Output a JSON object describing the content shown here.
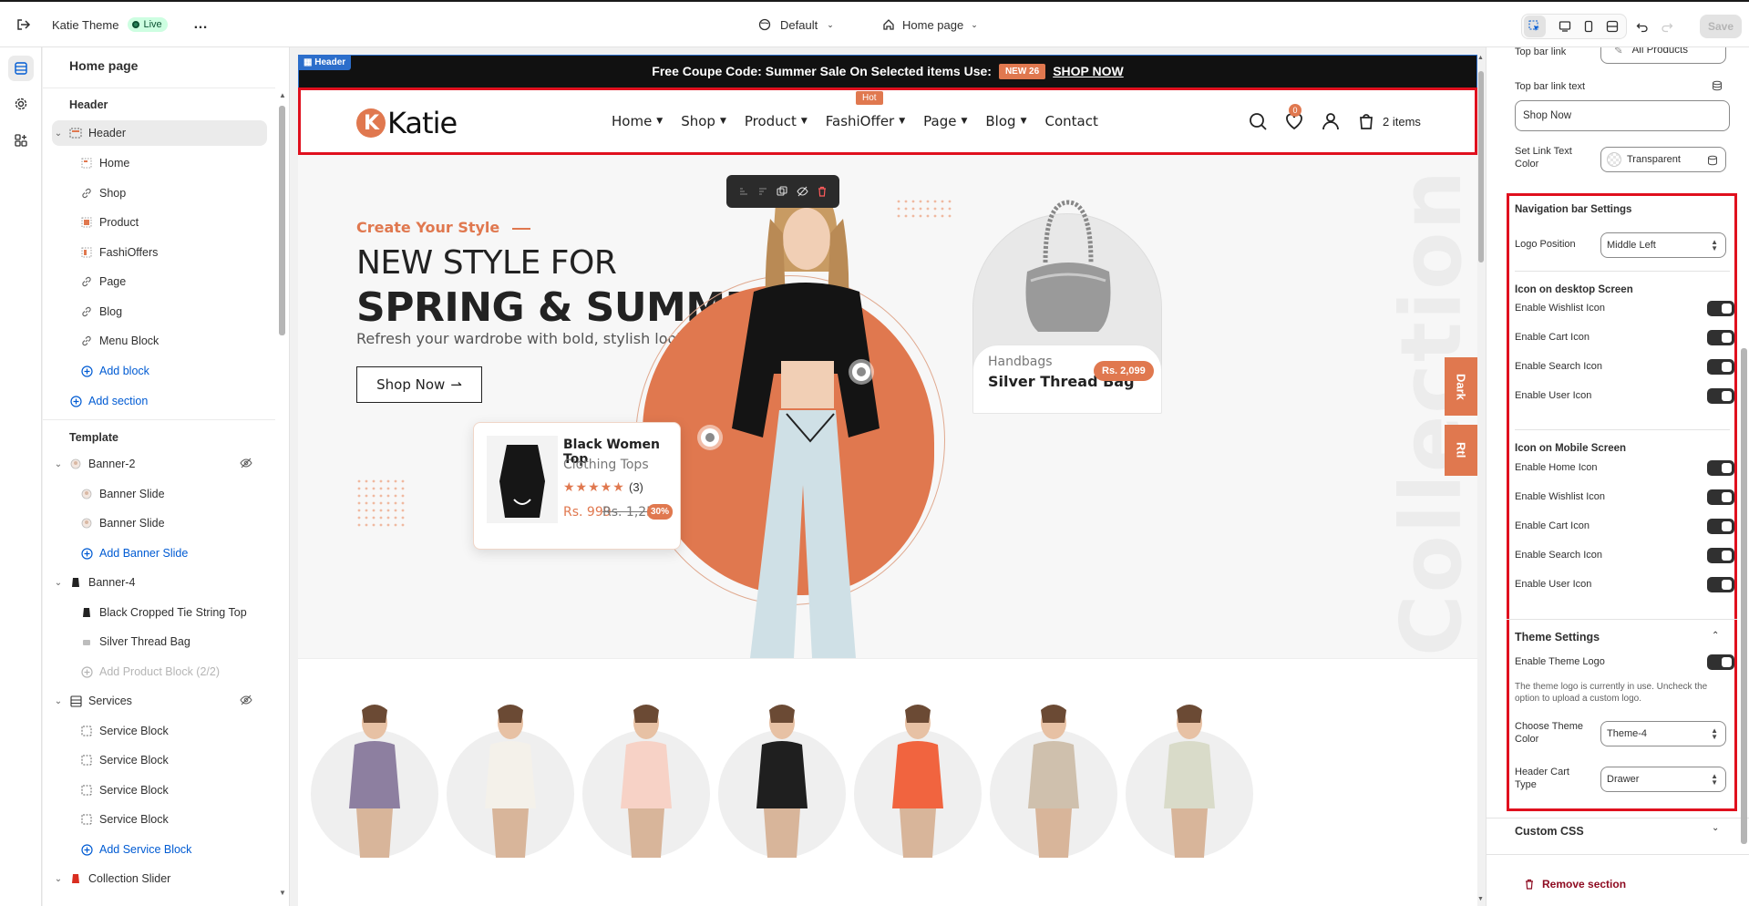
{
  "topbar": {
    "theme_name": "Katie Theme",
    "live_label": "Live",
    "more_label": "…",
    "preset": "Default",
    "page_selector": "Home page",
    "save_label": "Save"
  },
  "left_panel": {
    "title": "Home page",
    "header_section_label": "Header",
    "header_group": {
      "label": "Header",
      "items": [
        {
          "label": "Home",
          "icon": "menu-icon"
        },
        {
          "label": "Shop",
          "icon": "link-icon"
        },
        {
          "label": "Product",
          "icon": "menu-icon"
        },
        {
          "label": "FashiOffers",
          "icon": "menu-icon"
        },
        {
          "label": "Page",
          "icon": "link-icon"
        },
        {
          "label": "Blog",
          "icon": "link-icon"
        },
        {
          "label": "Menu Block",
          "icon": "link-icon"
        }
      ],
      "add_block": "Add block"
    },
    "add_section": "Add section",
    "template_label": "Template",
    "banner2": {
      "label": "Banner-2",
      "items": [
        "Banner Slide",
        "Banner Slide"
      ],
      "add": "Add Banner Slide"
    },
    "banner4": {
      "label": "Banner-4",
      "items": [
        "Black Cropped Tie String Top",
        "Silver Thread Bag"
      ],
      "add": "Add Product Block (2/2)"
    },
    "services": {
      "label": "Services",
      "items": [
        "Service Block",
        "Service Block",
        "Service Block",
        "Service Block"
      ],
      "add": "Add Service Block"
    },
    "collection_slider": {
      "label": "Collection Slider"
    }
  },
  "store": {
    "header_tag": "Header",
    "announcement": {
      "text": "Free Coupe Code: Summer Sale On Selected items Use:",
      "code": "NEW 26",
      "link": "SHOP NOW"
    },
    "logo_text": "Katie",
    "menu": [
      "Home",
      "Shop",
      "Product",
      "FashiOffer",
      "Page",
      "Blog",
      "Contact"
    ],
    "hot_badge": "Hot",
    "wishlist_count": "0",
    "cart_label": "2 items",
    "hero": {
      "subtitle": "Create Your Style",
      "title_line1": "NEW STYLE FOR",
      "title_line2": "SPRING & SUMMER",
      "description": "Refresh your wardrobe with bold, stylish looks from our Spring & Summer",
      "button": "Shop Now",
      "background_word": "Collection"
    },
    "product_card": {
      "name": "Black Women Top",
      "category": "Clothing Tops",
      "stars": "★★★★★",
      "review_count": "(3)",
      "price": "Rs. 999",
      "old_price": "Rs. 1,259",
      "discount": "30%"
    },
    "bag_card": {
      "category": "Handbags",
      "name": "Silver Thread Bag",
      "price": "Rs. 2,099"
    },
    "side_tabs": {
      "dark": "Dark",
      "rtl": "Rtl"
    },
    "category_count_visible": 7
  },
  "right_panel": {
    "top_bar_link_label": "Top bar link",
    "top_bar_link_value": "All Products",
    "top_bar_link_text_label": "Top bar link text",
    "top_bar_link_text_value": "Shop Now",
    "set_link_text_color_label": "Set Link Text Color",
    "set_link_text_color_value": "Transparent",
    "nav_heading": "Navigation bar Settings",
    "logo_position_label": "Logo Position",
    "logo_position_value": "Middle Left",
    "desktop_heading": "Icon on desktop Screen",
    "desktop_toggles": [
      "Enable Wishlist Icon",
      "Enable Cart Icon",
      "Enable Search Icon",
      "Enable User Icon"
    ],
    "mobile_heading": "Icon on Mobile Screen",
    "mobile_toggles": [
      "Enable Home Icon",
      "Enable Wishlist Icon",
      "Enable Cart Icon",
      "Enable Search Icon",
      "Enable User Icon"
    ],
    "theme_heading": "Theme Settings",
    "theme_logo_label": "Enable Theme Logo",
    "theme_logo_help": "The theme logo is currently in use. Uncheck the option to upload a custom logo.",
    "theme_color_label": "Choose Theme Color",
    "theme_color_value": "Theme-4",
    "cart_type_label": "Header Cart Type",
    "cart_type_value": "Drawer",
    "custom_css": "Custom CSS",
    "remove_section": "Remove section"
  },
  "colors": {
    "accent": "#e0784f",
    "selection_red": "#e0101e",
    "link_blue": "#005bd3",
    "toggle_on": "#303030"
  }
}
